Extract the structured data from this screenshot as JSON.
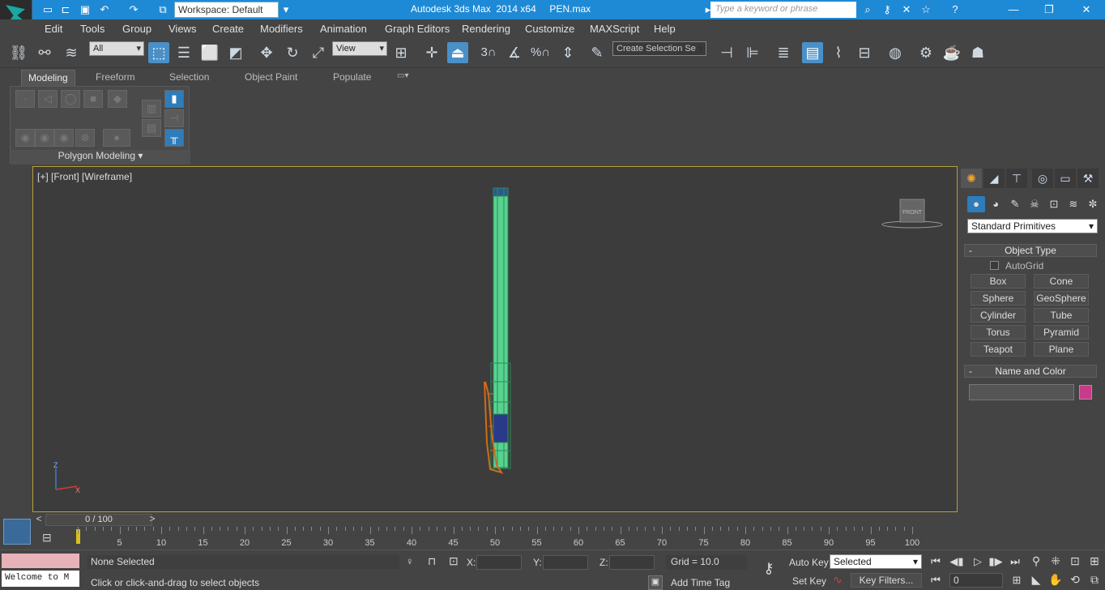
{
  "titlebar": {
    "workspace": "Workspace: Default",
    "title": "Autodesk 3ds Max  2014 x64     PEN.max",
    "search_placeholder": "Type a keyword or phrase"
  },
  "menu": [
    "Edit",
    "Tools",
    "Group",
    "Views",
    "Create",
    "Modifiers",
    "Animation",
    "Graph Editors",
    "Rendering",
    "Customize",
    "MAXScript",
    "Help"
  ],
  "toolbar": {
    "filter_value": "All",
    "coord_value": "View",
    "selection_set_placeholder": "Create Selection Se",
    "snap_labels": [
      "3",
      "%"
    ]
  },
  "ribbon": {
    "tabs": [
      "Modeling",
      "Freeform",
      "Selection",
      "Object Paint",
      "Populate"
    ],
    "active_tab": "Modeling",
    "panel_label": "Polygon Modeling"
  },
  "viewport": {
    "label": "[+] [Front] [Wireframe]",
    "viewcube_label": "FRONT",
    "axes": [
      "Z",
      "X"
    ]
  },
  "command_panel": {
    "category": "Standard Primitives",
    "object_type_header": "Object Type",
    "autogrid_label": "AutoGrid",
    "buttons": [
      "Box",
      "Cone",
      "Sphere",
      "GeoSphere",
      "Cylinder",
      "Tube",
      "Torus",
      "Pyramid",
      "Teapot",
      "Plane"
    ],
    "name_color_header": "Name and Color",
    "swatch_color": "#c83b8a"
  },
  "timeline": {
    "slider_label": "0 / 100",
    "ticks": [
      "0",
      "5",
      "10",
      "15",
      "20",
      "25",
      "30",
      "35",
      "40",
      "45",
      "50",
      "55",
      "60",
      "65",
      "70",
      "75",
      "80",
      "85",
      "90",
      "95",
      "100"
    ]
  },
  "status": {
    "welcome": "Welcome to M",
    "selection": "None Selected",
    "prompt": "Click or click-and-drag to select objects",
    "x_label": "X:",
    "y_label": "Y:",
    "z_label": "Z:",
    "grid": "Grid = 10.0",
    "add_time_tag": "Add Time Tag",
    "auto_key": "Auto Key",
    "set_key": "Set Key",
    "selected_value": "Selected",
    "key_filters": "Key Filters...",
    "frame": "0"
  }
}
